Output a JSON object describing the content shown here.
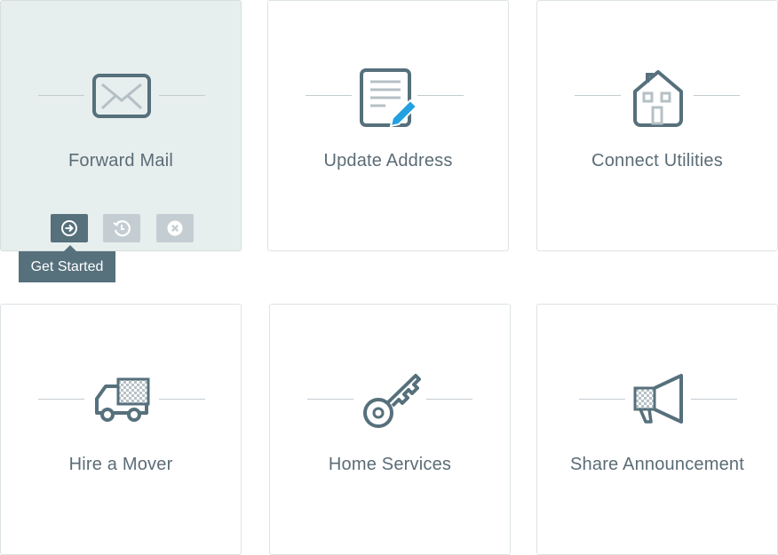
{
  "cards": [
    {
      "title": "Forward Mail",
      "icon": "envelope-icon"
    },
    {
      "title": "Update Address",
      "icon": "document-edit-icon"
    },
    {
      "title": "Connect Utilities",
      "icon": "house-icon"
    },
    {
      "title": "Hire a Mover",
      "icon": "moving-truck-icon"
    },
    {
      "title": "Home Services",
      "icon": "key-icon"
    },
    {
      "title": "Share Announcement",
      "icon": "megaphone-icon"
    }
  ],
  "actions": {
    "start_icon": "arrow-right-circle-icon",
    "later_icon": "clock-rewind-icon",
    "dismiss_icon": "close-circle-icon"
  },
  "tooltip": {
    "label": "Get Started"
  },
  "colors": {
    "accent": "#56707c",
    "accent_light": "#22a0e0",
    "active_card_bg": "#e7eeee",
    "text": "#5b6c76"
  }
}
